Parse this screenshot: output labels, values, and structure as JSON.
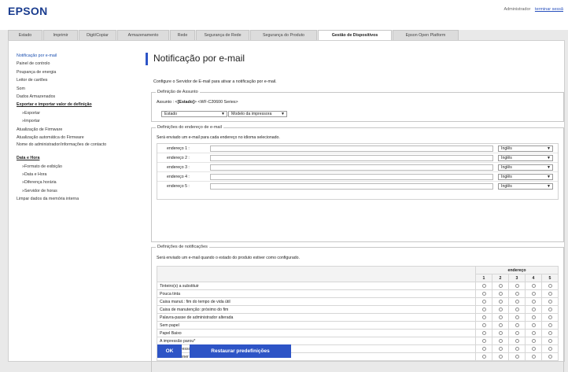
{
  "header": {
    "logo": "EPSON",
    "user": "Administrador",
    "logout": "terminar sessã"
  },
  "tabs": [
    {
      "label": "Estado"
    },
    {
      "label": "Imprimir"
    },
    {
      "label": "Digit/Copiar"
    },
    {
      "label": "Armazenamento"
    },
    {
      "label": "Rede"
    },
    {
      "label": "Segurança de Rede"
    },
    {
      "label": "Segurança do Produto"
    },
    {
      "label": "Gestão de Dispositivos"
    },
    {
      "label": "Epson Open Platform"
    }
  ],
  "sidebar": {
    "items": [
      {
        "label": "Notificação por e-mail"
      },
      {
        "label": "Painel de controlo"
      },
      {
        "label": "Poupança de energia"
      },
      {
        "label": "Leitor de cartões"
      },
      {
        "label": "Som"
      },
      {
        "label": "Dados Armazenados"
      },
      {
        "label": "Exportar e importar valor de definição"
      },
      {
        "label": "»Exportar"
      },
      {
        "label": "»Importar"
      },
      {
        "label": "Atualização de Firmware"
      },
      {
        "label": "Atualização automática do Firmware"
      },
      {
        "label": "Nome do administrador/informações de contacto"
      },
      {
        "label": "Data e Hora"
      },
      {
        "label": "»Formato de exibição"
      },
      {
        "label": "»Data e Hora"
      },
      {
        "label": "»Diferença horária"
      },
      {
        "label": "»Servidor de horas"
      },
      {
        "label": "Limpar dados da memória interna"
      }
    ]
  },
  "page": {
    "title": "Notificação por e-mail",
    "description": "Configure o Servidor de E-mail para ativar a notificação por e-mail."
  },
  "subject": {
    "legend": "Definição de Assunto",
    "line_prefix": "Assunto : <",
    "line_bold": "[Estado]",
    "line_suffix": "> <WF-C20600 Series>",
    "select1": "Estado",
    "select2": "Modelo da impressora"
  },
  "addresses": {
    "legend": "Definições do endereço de e-mail",
    "note": "Será enviado um e-mail para cada endereço no idioma selecionado.",
    "rows": [
      {
        "label": "endereço 1 :",
        "value": "",
        "lang": "Inglês"
      },
      {
        "label": "endereço 2 :",
        "value": "",
        "lang": "Inglês"
      },
      {
        "label": "endereço 3 :",
        "value": "",
        "lang": "Inglês"
      },
      {
        "label": "endereço 4 :",
        "value": "",
        "lang": "Inglês"
      },
      {
        "label": "endereço 5 :",
        "value": "",
        "lang": "Inglês"
      }
    ]
  },
  "notifications": {
    "legend": "Definições de notificações",
    "note": "Será enviado um e-mail quando o estado do produto estiver como configurado.",
    "group_header": "endereço",
    "columns": [
      "1",
      "2",
      "3",
      "4",
      "5"
    ],
    "rows": [
      {
        "label": "Tinteiro(s) a substituir"
      },
      {
        "label": "Pouca tinta"
      },
      {
        "label": "Caixa manut.: fim do tempo de vida útil"
      },
      {
        "label": "Caixa de manutenção: próximo do fim"
      },
      {
        "label": "Palavra-passe de administrador alterada"
      },
      {
        "label": "Sem papel"
      },
      {
        "label": "Papel Baixo"
      },
      {
        "label": "A impressão parou*"
      },
      {
        "label": "Erro da impressora"
      },
      {
        "label": "Erro do scanner"
      }
    ]
  },
  "buttons": {
    "ok": "OK",
    "restore": "Restaurar predefinições"
  },
  "colors": {
    "accent": "#2d54c6",
    "logo": "#1b3d8f"
  }
}
